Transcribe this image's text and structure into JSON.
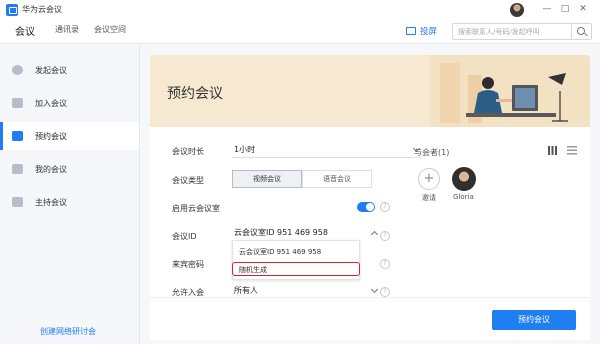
{
  "app": {
    "title": "华为云会议"
  },
  "nav": {
    "tabs": [
      {
        "label": "会议"
      },
      {
        "label": "通讯录"
      },
      {
        "label": "会议空间"
      }
    ],
    "cast_label": "投屏",
    "search_placeholder": "搜索联系人/号码/发起呼叫"
  },
  "window_controls": {
    "minimize": "—",
    "maximize": "□",
    "close": "✕"
  },
  "sidebar": {
    "items": [
      {
        "label": "发起会议",
        "icon": "phone-icon"
      },
      {
        "label": "加入会议",
        "icon": "join-icon"
      },
      {
        "label": "预约会议",
        "icon": "calendar-icon",
        "active": true
      },
      {
        "label": "我的会议",
        "icon": "list-icon"
      },
      {
        "label": "主持会议",
        "icon": "host-icon"
      }
    ],
    "webinar_link": "创建网络研讨会"
  },
  "schedule": {
    "banner_title": "预约会议",
    "duration": {
      "label": "会议时长",
      "value": "1小时"
    },
    "meeting_type": {
      "label": "会议类型",
      "options": [
        "视频会议",
        "语音会议"
      ],
      "selected": "视频会议"
    },
    "cloud_room": {
      "label": "启用云会议室",
      "enabled": true
    },
    "meeting_id": {
      "label": "会议ID",
      "value": "云会议室ID 951 469 958"
    },
    "guest_password": {
      "label": "来宾密码"
    },
    "allow_join": {
      "label": "允许入会",
      "value": "所有人"
    },
    "dropdown_options": [
      "云会议室ID 951 469 958",
      "随机生成"
    ],
    "help_glyph": "?",
    "attendees": {
      "title": "与会者(1)",
      "invite_glyph": "+",
      "invite_label": "邀请",
      "members": [
        {
          "name": "Gloria"
        }
      ]
    },
    "submit_label": "预约会议"
  },
  "colors": {
    "accent": "#1e7ef2",
    "highlight_border": "#d0252b",
    "banner_bg": "#f6e8d1"
  }
}
